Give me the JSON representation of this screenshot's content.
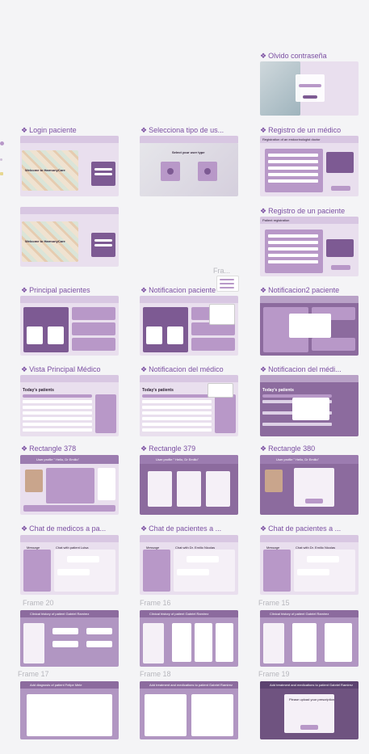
{
  "frames": {
    "olvido": "Olvido contraseña",
    "login": "Login paciente",
    "selecciona": "Selecciona tipo de us...",
    "registro_medico": "Registro de un médico",
    "registro_paciente": "Registro de un paciente",
    "fra": "Fra...",
    "principal_pacientes": "Principal pacientes",
    "notif_paciente": "Notificacion paciente",
    "notif2_paciente": "Notificacion2 paciente",
    "vista_medico": "Vista Principal Médico",
    "notif_medico": "Notificacion del médico",
    "notif_medico2": "Notificacion del médi...",
    "rect378": "Rectangle 378",
    "rect379": "Rectangle 379",
    "rect380": "Rectangle 380",
    "chat_medicos": "Chat de medicos a pa...",
    "chat_pacientes_a": "Chat de pacientes a ...",
    "chat_pacientes_b": "Chat de pacientes a ...",
    "frame20": "Frame 20",
    "frame16": "Frame 16",
    "frame15": "Frame 15",
    "frame17": "Frame 17",
    "frame18": "Frame 18",
    "frame19": "Frame 19"
  },
  "thumb_text": {
    "welcome": "Welcome to HarmonyCare",
    "select_user": "Select your user type",
    "patient": "Patient",
    "endocrinologist": "Endocrinologist",
    "reg_doctor": "Registration of an endocrinologist doctor",
    "reg_patient": "Patient registration",
    "todays_patients": "Today's patients",
    "user_profile": "User profile \" Hello, Dr Emilio\"",
    "clinical_gabriel": "Clinical history of patient Gabriel Ramirez",
    "add_diagnosis": "Add diagnosis of patient Felipe Mele",
    "add_treatment": "Add treatment and medications to patient Gabriel Ramirez",
    "upload_prescription": "Please upload your prescription",
    "message": "Message",
    "chat_luisa": "Chat with patient Luisa",
    "chat_nicolas": "Chat with Dr. Emilio Nicolas"
  },
  "colors": {
    "accent": "#7b4fa2",
    "frame": "#e9dfee",
    "dark": "#8c6b9e",
    "bg": "#f4f4f6"
  }
}
